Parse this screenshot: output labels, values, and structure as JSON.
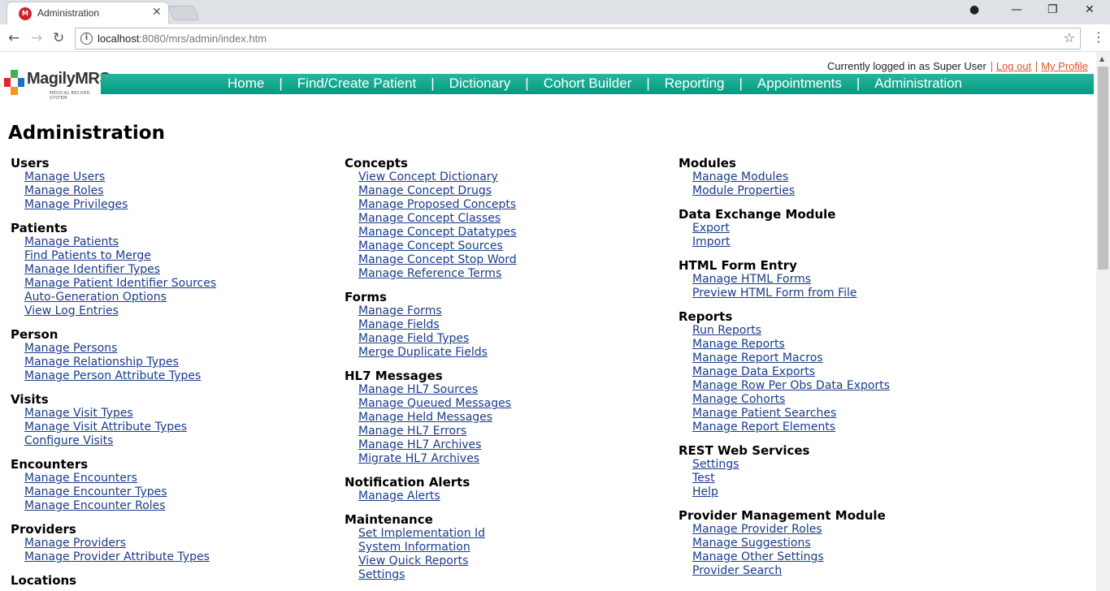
{
  "browser": {
    "tab_title": "Administration",
    "tab_favicon": "M",
    "url_host": "localhost",
    "url_rest": ":8080/mrs/admin/index.htm"
  },
  "header": {
    "logo_text": "MagilyMRS",
    "logo_sub": "MEDICAL RECORD SYSTEM",
    "logged_in": "Currently logged in as Super User",
    "logout": "Log out",
    "profile": "My Profile"
  },
  "nav": [
    "Home",
    "Find/Create Patient",
    "Dictionary",
    "Cohort Builder",
    "Reporting",
    "Appointments",
    "Administration"
  ],
  "page_title": "Administration",
  "columns": [
    [
      {
        "title": "Users",
        "links": [
          "Manage Users",
          "Manage Roles",
          "Manage Privileges"
        ]
      },
      {
        "title": "Patients",
        "links": [
          "Manage Patients",
          "Find Patients to Merge",
          "Manage Identifier Types",
          "Manage Patient Identifier Sources",
          "Auto-Generation Options",
          "View Log Entries"
        ]
      },
      {
        "title": "Person",
        "links": [
          "Manage Persons",
          "Manage Relationship Types",
          "Manage Person Attribute Types"
        ]
      },
      {
        "title": "Visits",
        "links": [
          "Manage Visit Types",
          "Manage Visit Attribute Types",
          "Configure Visits"
        ]
      },
      {
        "title": "Encounters",
        "links": [
          "Manage Encounters",
          "Manage Encounter Types",
          "Manage Encounter Roles"
        ]
      },
      {
        "title": "Providers",
        "links": [
          "Manage Providers",
          "Manage Provider Attribute Types"
        ]
      },
      {
        "title": "Locations",
        "links": []
      }
    ],
    [
      {
        "title": "Concepts",
        "links": [
          "View Concept Dictionary",
          "Manage Concept Drugs",
          "Manage Proposed Concepts",
          "Manage Concept Classes",
          "Manage Concept Datatypes",
          "Manage Concept Sources",
          "Manage Concept Stop Word",
          "Manage Reference Terms"
        ]
      },
      {
        "title": "Forms",
        "links": [
          "Manage Forms",
          "Manage Fields",
          "Manage Field Types",
          "Merge Duplicate Fields"
        ]
      },
      {
        "title": "HL7 Messages",
        "links": [
          "Manage HL7 Sources",
          "Manage Queued Messages",
          "Manage Held Messages",
          "Manage HL7 Errors",
          "Manage HL7 Archives",
          "Migrate HL7 Archives"
        ]
      },
      {
        "title": "Notification Alerts",
        "links": [
          "Manage Alerts"
        ]
      },
      {
        "title": "Maintenance",
        "links": [
          "Set Implementation Id",
          "System Information",
          "View Quick Reports",
          "Settings"
        ]
      }
    ],
    [
      {
        "title": "Modules",
        "links": [
          "Manage Modules",
          "Module Properties"
        ]
      },
      {
        "title": "Data Exchange Module",
        "links": [
          "Export",
          "Import"
        ]
      },
      {
        "title": "HTML Form Entry",
        "links": [
          "Manage HTML Forms",
          "Preview HTML Form from File"
        ]
      },
      {
        "title": "Reports",
        "links": [
          "Run Reports",
          "Manage Reports",
          "Manage Report Macros",
          "Manage Data Exports",
          "Manage Row Per Obs Data Exports",
          "Manage Cohorts",
          "Manage Patient Searches",
          "Manage Report Elements"
        ]
      },
      {
        "title": "REST Web Services",
        "links": [
          "Settings",
          "Test",
          "Help"
        ]
      },
      {
        "title": "Provider Management Module",
        "links": [
          "Manage Provider Roles",
          "Manage Suggestions",
          "Manage Other Settings",
          "Provider Search"
        ]
      }
    ]
  ]
}
